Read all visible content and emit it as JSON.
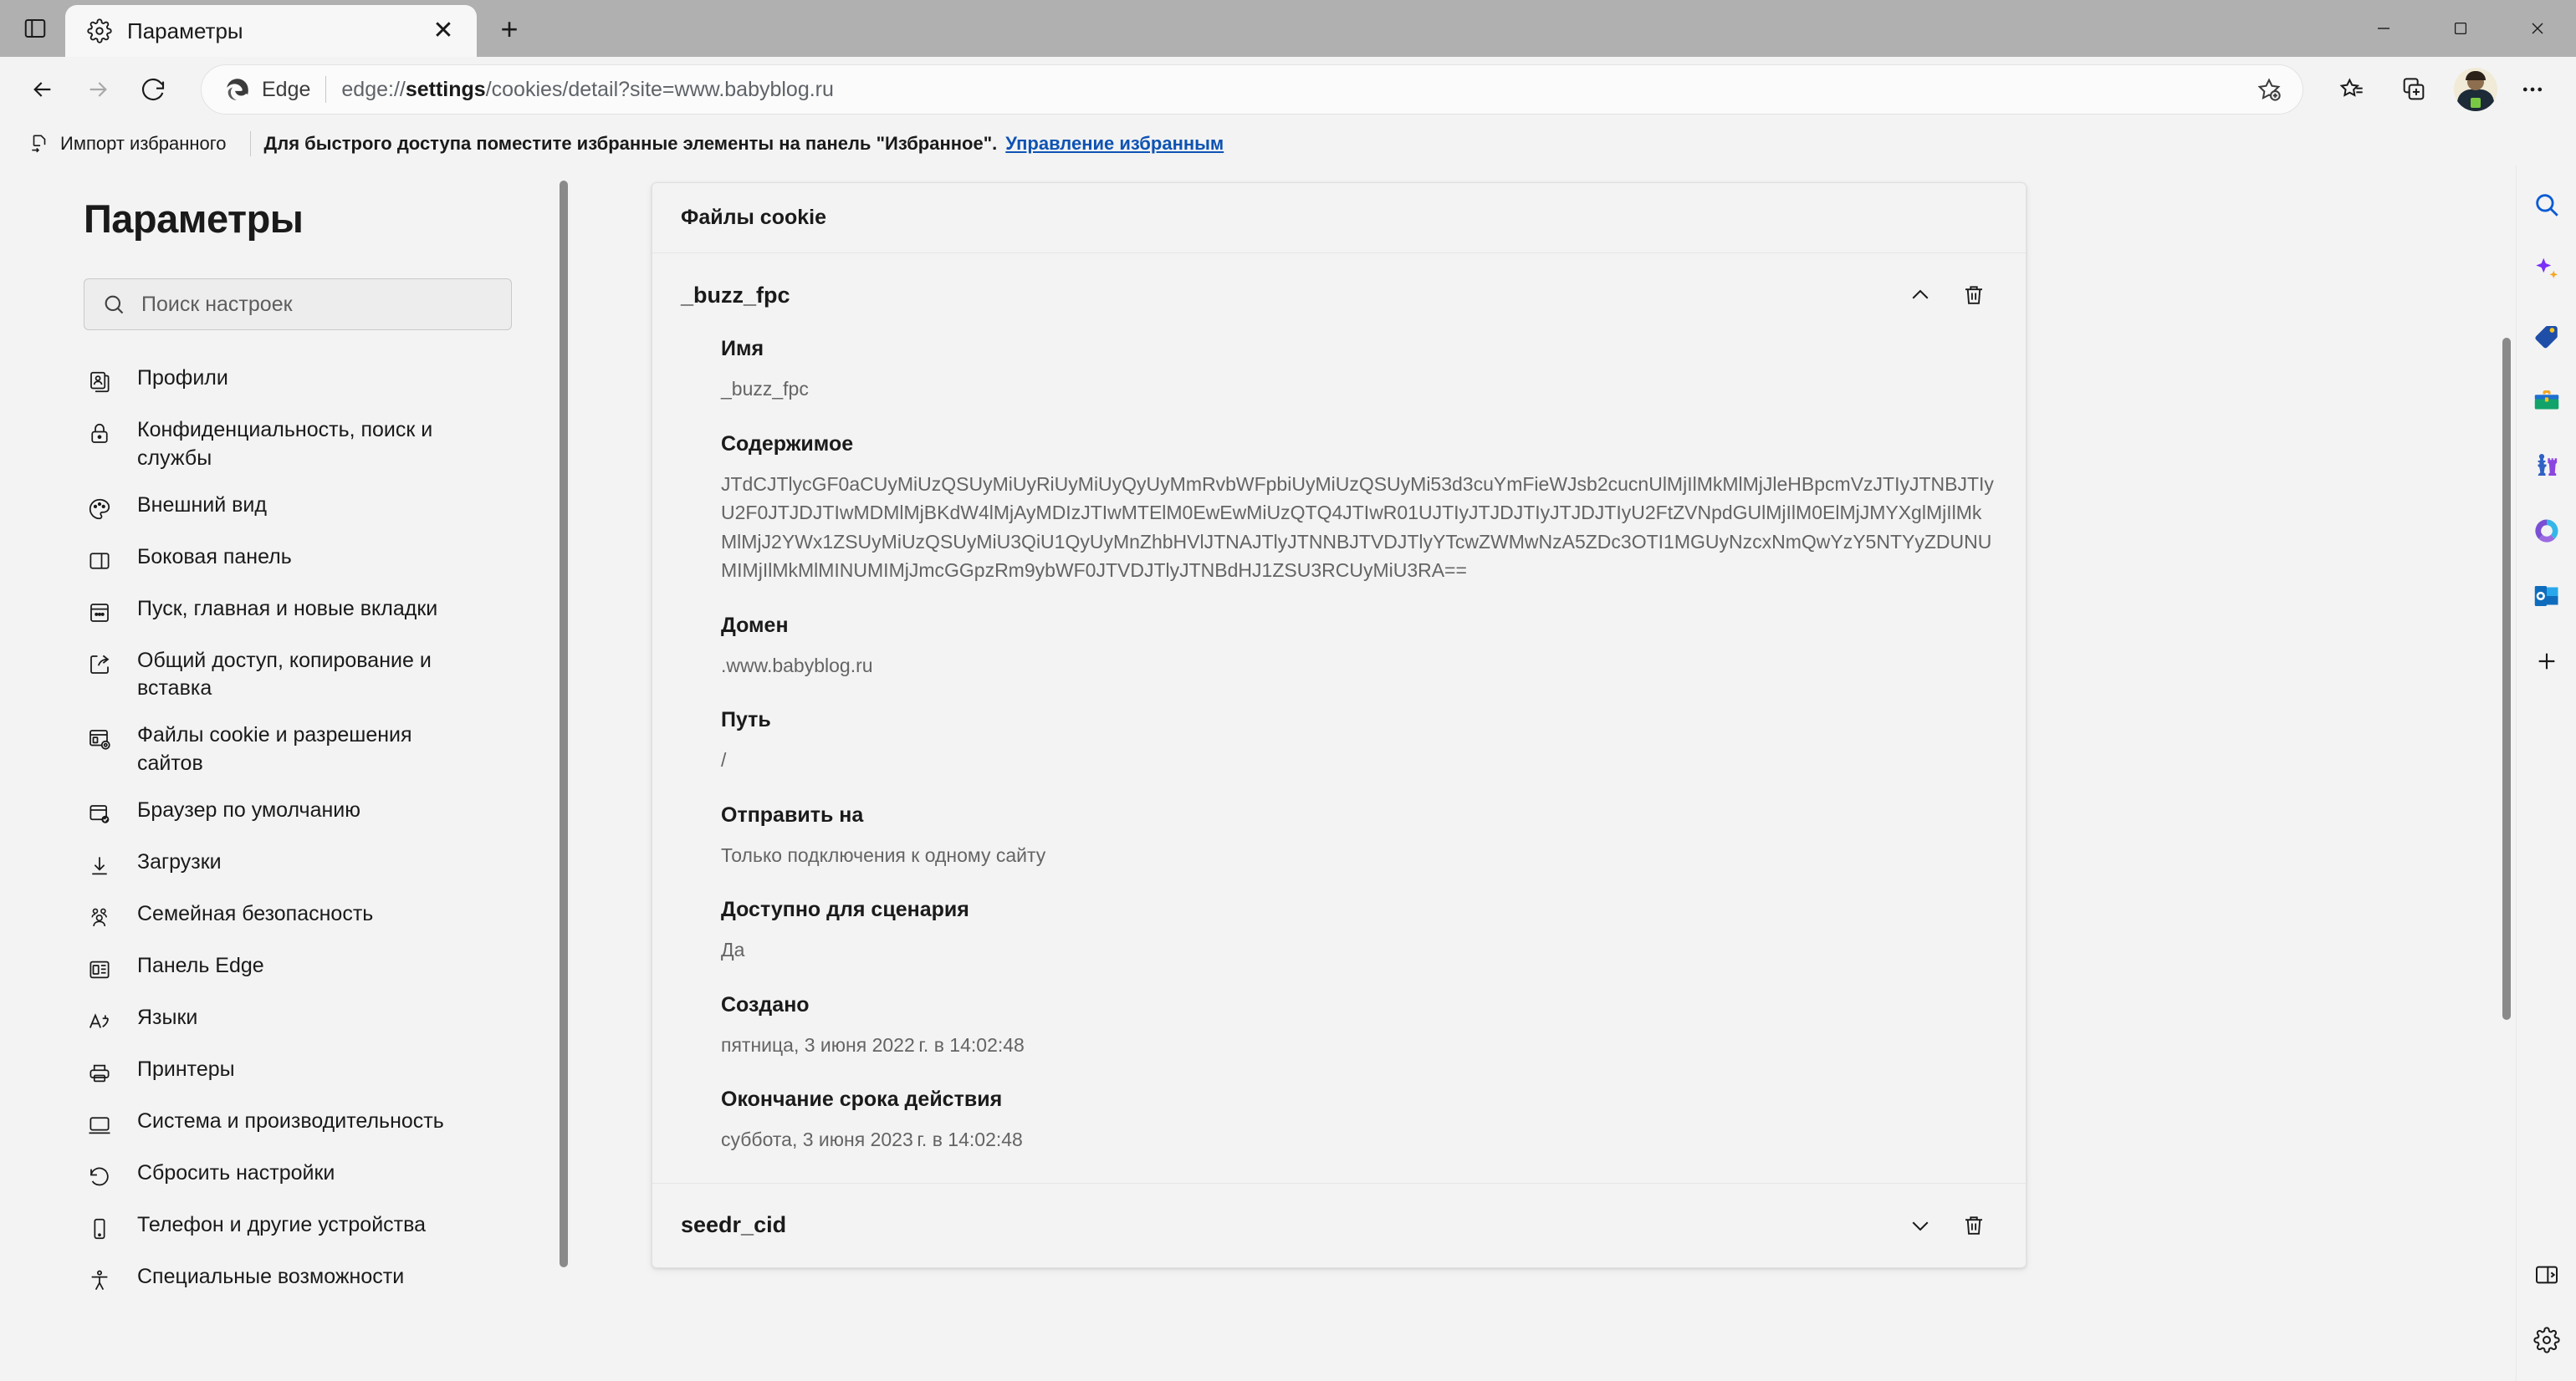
{
  "window": {
    "minimize_label": "—",
    "maximize_label": "☐",
    "close_label": "✕"
  },
  "tab": {
    "title": "Параметры",
    "close_label": "✕",
    "newtab_label": "+"
  },
  "omnibox": {
    "brand": "Edge",
    "url_prefix": "edge://",
    "url_bold": "settings",
    "url_suffix": "/cookies/detail?site=www.babyblog.ru",
    "full_url": "edge://settings/cookies/detail?site=www.babyblog.ru"
  },
  "favbar": {
    "import_label": "Импорт избранного",
    "hint": "Для быстрого доступа поместите избранные элементы на панель \"Избранное\".",
    "manage_link": "Управление избранным"
  },
  "sidebar": {
    "title": "Параметры",
    "search_placeholder": "Поиск настроек",
    "search_value": "",
    "items": [
      {
        "label": "Профили",
        "icon": "profile-icon"
      },
      {
        "label": "Конфиденциальность, поиск и службы",
        "icon": "lock-icon"
      },
      {
        "label": "Внешний вид",
        "icon": "palette-icon"
      },
      {
        "label": "Боковая панель",
        "icon": "sidebar-icon"
      },
      {
        "label": "Пуск, главная и новые вкладки",
        "icon": "newtab-page-icon"
      },
      {
        "label": "Общий доступ, копирование и вставка",
        "icon": "share-icon"
      },
      {
        "label": "Файлы cookie и разрешения сайтов",
        "icon": "cookies-icon"
      },
      {
        "label": "Браузер по умолчанию",
        "icon": "default-browser-icon"
      },
      {
        "label": "Загрузки",
        "icon": "download-icon"
      },
      {
        "label": "Семейная безопасность",
        "icon": "family-icon"
      },
      {
        "label": "Панель Edge",
        "icon": "edge-bar-icon"
      },
      {
        "label": "Языки",
        "icon": "language-icon"
      },
      {
        "label": "Принтеры",
        "icon": "printer-icon"
      },
      {
        "label": "Система и производительность",
        "icon": "system-icon"
      },
      {
        "label": "Сбросить настройки",
        "icon": "reset-icon"
      },
      {
        "label": "Телефон и другие устройства",
        "icon": "phone-icon"
      },
      {
        "label": "Специальные возможности",
        "icon": "accessibility-icon"
      }
    ]
  },
  "main": {
    "card_header": "Файлы cookie",
    "cookies": [
      {
        "name": "_buzz_fpc",
        "expanded": true,
        "fields": [
          {
            "label": "Имя",
            "value": "_buzz_fpc"
          },
          {
            "label": "Содержимое",
            "value": "JTdCJTlycGF0aCUyMiUzQSUyMiUyRiUyMiUyQyUyMmRvbWFpbiUyMiUzQSUyMi53d3cuYmFieWJsb2cucnUlMjIlMkMlMjJleHBpcmVzJTIyJTNBJTIyU2F0JTJDJTIwMDMlMjBKdW4lMjAyMDIzJTIwMTElM0EwEwMiUzQTQ4JTIwR01UJTIyJTJDJTIyJTJDJTIyU2FtZVNpdGUlMjIlM0ElMjJMYXglMjIlMkMlMjJ2YWx1ZSUyMiUzQSUyMiU3QiU1QyUyMnZhbHVlJTNAJTlyJTNNBJTVDJTlyYTcwZWMwNzA5ZDc3OTI1MGUyNzcxNmQwYzY5NTYyZDUNUMIMjIlMkMlMINUMIMjJmcGGpzRm9ybWF0JTVDJTlyJTNBdHJ1ZSU3RCUyMiU3RA=="
          },
          {
            "label": "Домен",
            "value": ".www.babyblog.ru"
          },
          {
            "label": "Путь",
            "value": "/"
          },
          {
            "label": "Отправить на",
            "value": "Только подключения к одному сайту"
          },
          {
            "label": "Доступно для сценария",
            "value": "Да"
          },
          {
            "label": "Создано",
            "value": "пятница, 3 июня 2022 г. в 14:02:48"
          },
          {
            "label": "Окончание срока действия",
            "value": "суббота, 3 июня 2023 г. в 14:02:48"
          }
        ]
      },
      {
        "name": "seedr_cid",
        "expanded": false,
        "fields": []
      }
    ]
  },
  "edgebar": {
    "items": [
      {
        "name": "search-icon"
      },
      {
        "name": "copilot-icon"
      },
      {
        "name": "shopping-tag-icon"
      },
      {
        "name": "tools-icon"
      },
      {
        "name": "games-icon"
      },
      {
        "name": "office-icon"
      },
      {
        "name": "outlook-icon"
      },
      {
        "name": "add-icon"
      }
    ],
    "bottom": [
      {
        "name": "split-screen-icon"
      },
      {
        "name": "settings-gear-icon"
      }
    ]
  },
  "colors": {
    "accent": "#0d53b3",
    "page_bg": "#f3f3f3",
    "titlebar_bg": "#b0b0b0",
    "card_border": "#e0e0e0",
    "text": "#1a1a1a",
    "muted_text": "#646464"
  }
}
